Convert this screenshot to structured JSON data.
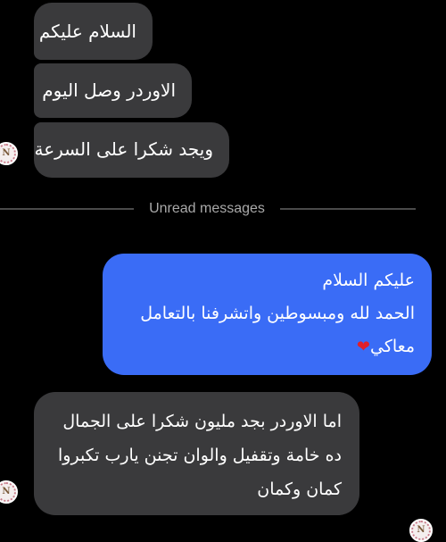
{
  "messages": [
    {
      "id": "m1",
      "direction": "incoming",
      "lines": [
        "السلام عليكم"
      ]
    },
    {
      "id": "m2",
      "direction": "incoming",
      "lines": [
        "الاوردر وصل اليوم"
      ]
    },
    {
      "id": "m3",
      "direction": "incoming",
      "lines": [
        "ويجد شكرا على السرعة"
      ]
    },
    {
      "id": "m4",
      "direction": "outgoing",
      "lines": [
        "عليكم السلام",
        "الحمد لله ومبسوطين واتشرفنا بالتعامل",
        "معاكي"
      ],
      "emoji": "heart"
    },
    {
      "id": "m5",
      "direction": "incoming",
      "lines": [
        "اما الاوردر بجد مليون شكرا على الجمال",
        "ده خامة وتقفيل والوان تجنن يارب تكبروا",
        "كمان وكمان"
      ]
    }
  ],
  "divider": {
    "label": "Unread messages"
  },
  "avatar": {
    "letter": "N"
  },
  "colors": {
    "background": "#000000",
    "incoming_bubble": "#3a3a3c",
    "outgoing_bubble": "#3a6cf6",
    "heart": "#e0202a",
    "divider": "#4a4a4a"
  }
}
